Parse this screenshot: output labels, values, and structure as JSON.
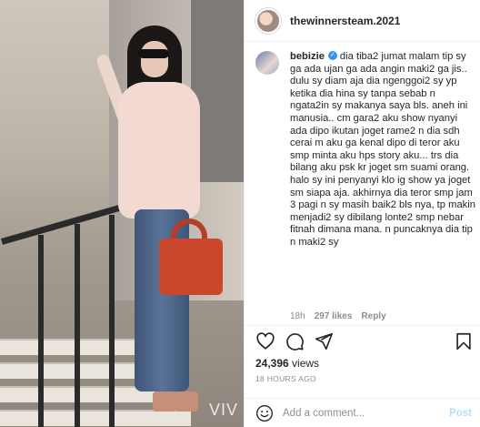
{
  "post": {
    "author_username": "thewinnersteam.2021",
    "views_count": "24,396",
    "views_label": "views",
    "timestamp": "18 HOURS AGO"
  },
  "media": {
    "watermark_text": "VIV"
  },
  "comment": {
    "username": "bebizie",
    "verified": true,
    "text": "dia tiba2 jumat malam tip sy ga ada ujan ga ada angin maki2 ga jis.. dulu sy diam aja dia ngenggoi2 sy yp ketika dia hina sy tanpa sebab n ngata2in sy makanya saya bls. aneh ini manusia.. cm gara2 aku show nyanyi ada dipo ikutan joget rame2 n dia sdh cerai m aku ga kenal dipo di teror aku smp minta aku hps story aku... trs dia bilang aku psk kr joget sm suami orang. halo sy ini penyanyi klo ig show ya joget sm siapa aja. akhirnya dia teror smp jam 3 pagi n sy masih baik2 bls nya, tp makin menjadi2 sy dibilang lonte2 smp nebar fitnah dimana mana. n puncaknya dia tip n maki2 sy",
    "time": "18h",
    "likes": "297 likes",
    "reply_label": "Reply"
  },
  "icons": {
    "like": "heart-icon",
    "comment": "comment-bubble-icon",
    "share": "paper-plane-icon",
    "save": "bookmark-icon",
    "emoji": "smiley-icon",
    "verified": "verified-badge-icon"
  },
  "input": {
    "placeholder": "Add a comment...",
    "value": "",
    "post_label": "Post"
  },
  "colors": {
    "verified": "#3897f0",
    "post_button_disabled": "#b2dffc",
    "muted_text": "#8e8e8e"
  }
}
